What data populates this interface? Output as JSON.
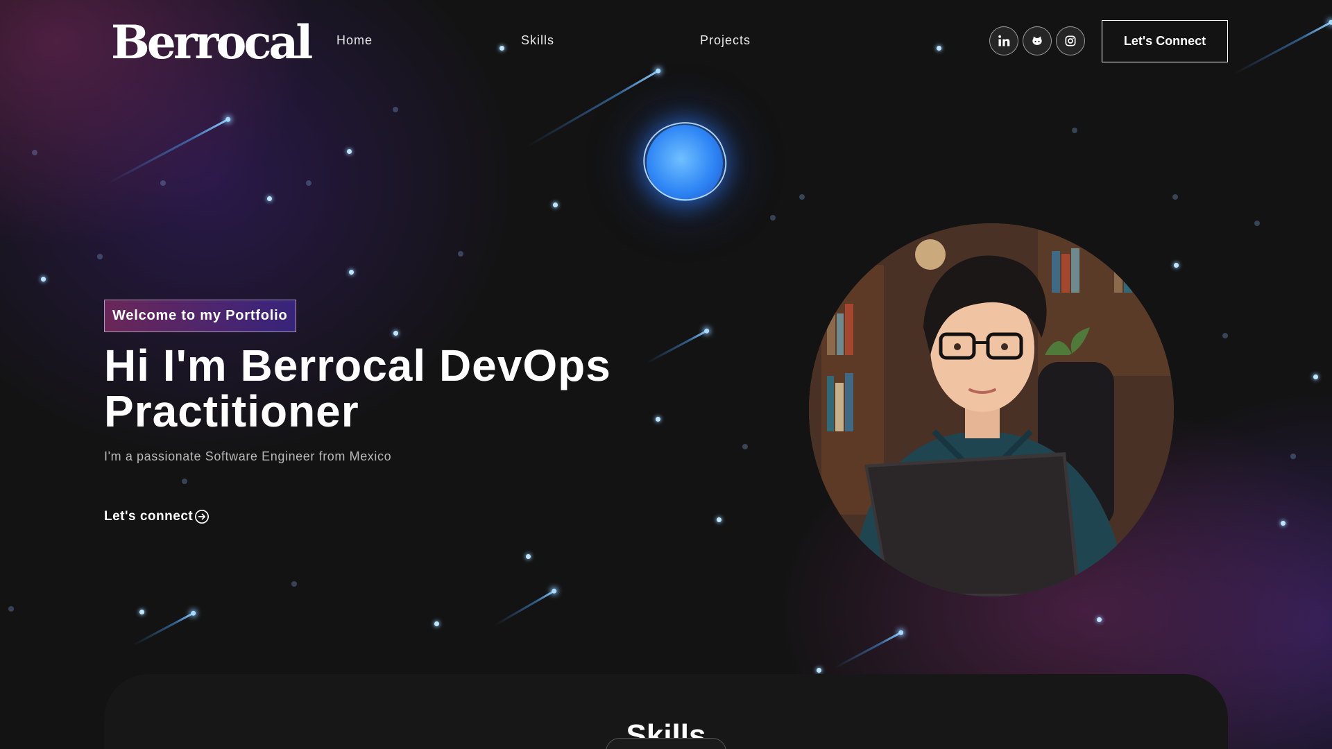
{
  "brand": {
    "logo_text": "Berrocal"
  },
  "nav": {
    "links": [
      {
        "label": "Home"
      },
      {
        "label": "Skills"
      },
      {
        "label": "Projects"
      }
    ],
    "social": [
      {
        "icon": "linkedin-icon"
      },
      {
        "icon": "github-icon"
      },
      {
        "icon": "instagram-icon"
      }
    ],
    "cta_label": "Let's Connect"
  },
  "hero": {
    "tagline": "Welcome to my Portfolio",
    "title": "Hi I'm Berrocal DevOps Practitioner",
    "subtitle": "I'm a passionate Software Engineer from Mexico",
    "cta_label": "Let's connect",
    "cta_icon": "arrow-right-circle-icon",
    "avatar_icon": "developer-avatar"
  },
  "skills": {
    "title": "Skills"
  },
  "colors": {
    "background": "#121212",
    "tagline_gradient_start": "#aa367c",
    "tagline_gradient_end": "#4a2fbd",
    "orb_blue": "#2f86f5",
    "star_blue": "#bfe6ff"
  }
}
